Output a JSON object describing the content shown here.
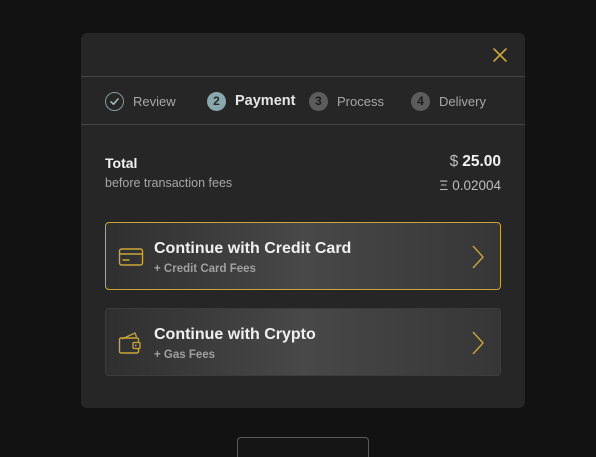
{
  "modal": {
    "close_icon": "close-icon",
    "accent_color": "#c9a63a"
  },
  "steps": [
    {
      "label": "Review",
      "badge": "",
      "state": "done",
      "icon": "check-icon"
    },
    {
      "label": "Payment",
      "badge": "2",
      "state": "active"
    },
    {
      "label": "Process",
      "badge": "3",
      "state": "pending"
    },
    {
      "label": "Delivery",
      "badge": "4",
      "state": "pending"
    }
  ],
  "total": {
    "title": "Total",
    "subtitle": "before transaction fees",
    "usd_symbol": "$",
    "usd_amount": "25.00",
    "eth_symbol": "Ξ",
    "eth_amount": "0.02004"
  },
  "options": {
    "credit": {
      "title": "Continue with Credit Card",
      "subtitle": "+ Credit Card Fees",
      "icon": "credit-card-icon",
      "selected": true
    },
    "crypto": {
      "title": "Continue with Crypto",
      "subtitle": "+ Gas Fees",
      "icon": "wallet-icon",
      "selected": false
    }
  }
}
